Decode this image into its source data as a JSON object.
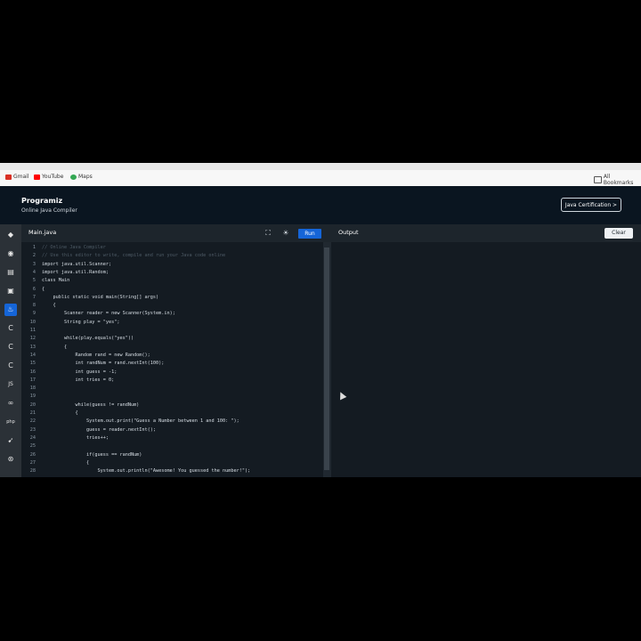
{
  "bookmarks": {
    "items": [
      {
        "label": "Gmail",
        "icon": "gmail-icon"
      },
      {
        "label": "YouTube",
        "icon": "youtube-icon"
      },
      {
        "label": "Maps",
        "icon": "maps-icon"
      }
    ],
    "all_bookmarks": "All Bookmarks"
  },
  "header": {
    "logo": "Programiz",
    "subtitle": "Online Java Compiler",
    "cert_button": "Java Certification >"
  },
  "sidebar": {
    "icons": [
      "python-icon",
      "r-icon",
      "sql-icon",
      "html-icon",
      "java-icon",
      "c-icon",
      "cpp-icon",
      "csharp-icon",
      "js-icon",
      "go-icon",
      "php-icon",
      "swift-icon",
      "rust-icon"
    ],
    "active": "java-icon"
  },
  "editor": {
    "file_tab": "Main.java",
    "run_label": "Run",
    "lines": [
      {
        "no": "1",
        "text": "// Online Java Compiler"
      },
      {
        "no": "2",
        "text": "// Use this editor to write, compile and run your Java code online"
      },
      {
        "no": "3",
        "text": "import java.util.Scanner;"
      },
      {
        "no": "4",
        "text": "import java.util.Random;"
      },
      {
        "no": "5",
        "text": "class Main"
      },
      {
        "no": "6",
        "text": "{"
      },
      {
        "no": "7",
        "text": "    public static void main(String[] args)"
      },
      {
        "no": "8",
        "text": "    {"
      },
      {
        "no": "9",
        "text": "        Scanner reader = new Scanner(System.in);"
      },
      {
        "no": "10",
        "text": "        String play = \"yes\";"
      },
      {
        "no": "11",
        "text": ""
      },
      {
        "no": "12",
        "text": "        while(play.equals(\"yes\"))"
      },
      {
        "no": "13",
        "text": "        {"
      },
      {
        "no": "14",
        "text": "            Random rand = new Random();"
      },
      {
        "no": "15",
        "text": "            int randNum = rand.nextInt(100);"
      },
      {
        "no": "16",
        "text": "            int guess = -1;"
      },
      {
        "no": "17",
        "text": "            int tries = 0;"
      },
      {
        "no": "18",
        "text": ""
      },
      {
        "no": "19",
        "text": ""
      },
      {
        "no": "20",
        "text": "            while(guess != randNum)"
      },
      {
        "no": "21",
        "text": "            {"
      },
      {
        "no": "22",
        "text": "                System.out.print(\"Guess a Number between 1 and 100: \");"
      },
      {
        "no": "23",
        "text": "                guess = reader.nextInt();"
      },
      {
        "no": "24",
        "text": "                tries++;"
      },
      {
        "no": "25",
        "text": ""
      },
      {
        "no": "26",
        "text": "                if(guess == randNum)"
      },
      {
        "no": "27",
        "text": "                {"
      },
      {
        "no": "28",
        "text": "                    System.out.println(\"Awesome! You guessed the number!\");"
      }
    ]
  },
  "output": {
    "title": "Output",
    "clear_label": "Clear"
  },
  "colors": {
    "accent": "#1565d8",
    "editor_bg": "#141b22",
    "header_bg": "#0a1520"
  }
}
